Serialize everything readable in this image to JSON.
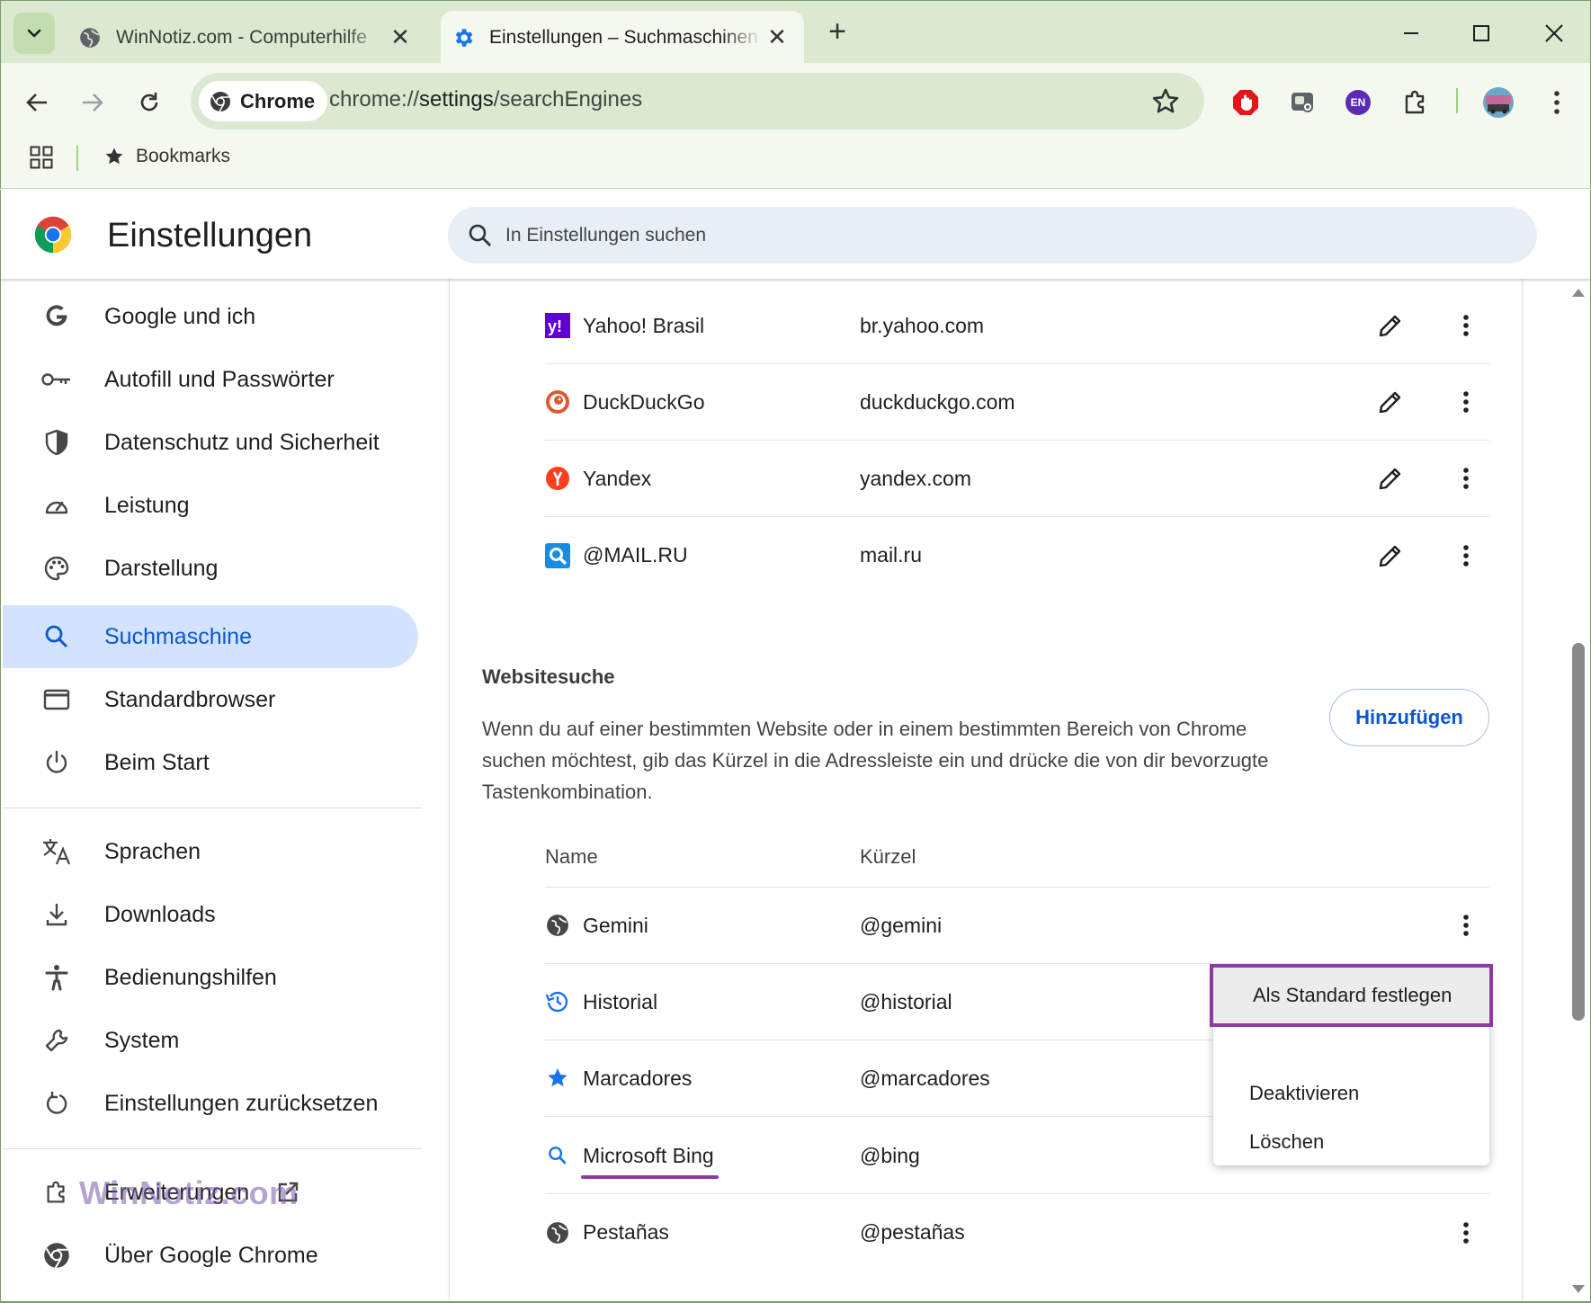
{
  "tabs": [
    {
      "title": "WinNotiz.com - Computerhilfe",
      "active": false,
      "icon": "globe-icon"
    },
    {
      "title": "Einstellungen – Suchmaschinen",
      "active": true,
      "icon": "gear-icon"
    }
  ],
  "toolbar": {
    "chip_label": "Chrome",
    "url_prefix": "chrome://",
    "url_host": "settings",
    "url_path": "/searchEngines",
    "extensions": [
      "adblock-icon",
      "screencast-icon",
      "language-en-icon",
      "puzzle-icon"
    ],
    "language_badge": "EN"
  },
  "bookmarks": {
    "label": "Bookmarks"
  },
  "settings": {
    "title": "Einstellungen",
    "search_placeholder": "In Einstellungen suchen"
  },
  "sidebar": {
    "items": [
      {
        "label": "Google und ich",
        "icon": "google-g-icon"
      },
      {
        "label": "Autofill und Passwörter",
        "icon": "key-icon"
      },
      {
        "label": "Datenschutz und Sicherheit",
        "icon": "shield-icon"
      },
      {
        "label": "Leistung",
        "icon": "speedometer-icon"
      },
      {
        "label": "Darstellung",
        "icon": "palette-icon"
      },
      {
        "label": "Suchmaschine",
        "icon": "search-icon",
        "active": true
      },
      {
        "label": "Standardbrowser",
        "icon": "browser-window-icon"
      },
      {
        "label": "Beim Start",
        "icon": "power-icon"
      },
      {
        "label": "Sprachen",
        "icon": "translate-icon"
      },
      {
        "label": "Downloads",
        "icon": "download-icon"
      },
      {
        "label": "Bedienungshilfen",
        "icon": "accessibility-icon"
      },
      {
        "label": "System",
        "icon": "wrench-icon"
      },
      {
        "label": "Einstellungen zurücksetzen",
        "icon": "reset-icon"
      },
      {
        "label": "Erweiterungen",
        "icon": "puzzle-icon"
      },
      {
        "label": "Über Google Chrome",
        "icon": "chrome-icon"
      }
    ],
    "watermark": "WinNotiz.com"
  },
  "search_engines": [
    {
      "name": "Yahoo! Brasil",
      "keyword": "br.yahoo.com",
      "icon": "yahoo-icon"
    },
    {
      "name": "DuckDuckGo",
      "keyword": "duckduckgo.com",
      "icon": "duckduckgo-icon"
    },
    {
      "name": "Yandex",
      "keyword": "yandex.com",
      "icon": "yandex-icon"
    },
    {
      "name": "@MAIL.RU",
      "keyword": "mail.ru",
      "icon": "mailru-icon"
    }
  ],
  "site_search": {
    "title": "Websitesuche",
    "description": "Wenn du auf einer bestimmten Website oder in einem bestimmten Bereich von Chrome suchen möchtest, gib das Kürzel in die Adressleiste ein und drücke die von dir bevorzugte Tastenkombination.",
    "add_button": "Hinzufügen",
    "col_name": "Name",
    "col_keyword": "Kürzel",
    "rows": [
      {
        "name": "Gemini",
        "keyword": "@gemini",
        "icon": "globe-icon"
      },
      {
        "name": "Historial",
        "keyword": "@historial",
        "icon": "history-icon"
      },
      {
        "name": "Marcadores",
        "keyword": "@marcadores",
        "icon": "star-icon"
      },
      {
        "name": "Microsoft Bing",
        "keyword": "@bing",
        "icon": "search-icon"
      },
      {
        "name": "Pestañas",
        "keyword": "@pestañas",
        "icon": "globe-icon"
      }
    ]
  },
  "context_menu": {
    "items": [
      {
        "label": "Als Standard festlegen",
        "highlighted": true
      },
      {
        "label": "Deaktivieren"
      },
      {
        "label": "Löschen"
      }
    ]
  },
  "colors": {
    "accent": "#0b57d0",
    "active_nav_bg": "#d3e3fd",
    "highlight_outline": "#8e3aa3",
    "tabstrip_bg": "#dbe9d0"
  }
}
